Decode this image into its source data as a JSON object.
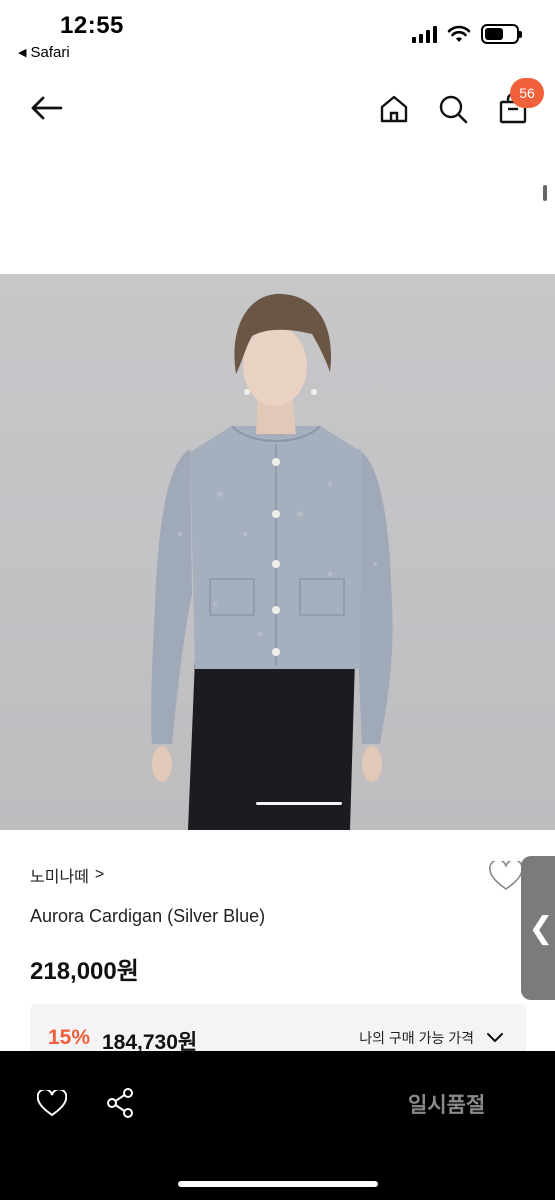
{
  "status_bar": {
    "time": "12:55",
    "back_app": "Safari"
  },
  "header": {
    "cart_count": "56"
  },
  "product": {
    "brand": "노미나떼",
    "brand_chevron": ">",
    "name": "Aurora Cardigan (Silver Blue)",
    "price": "218,000원",
    "discount": {
      "rate": "15%",
      "price": "184,730원",
      "my_price_label": "나의 구매 가능 가격"
    }
  },
  "side_tab": {
    "arrow": "❮"
  },
  "bottom_bar": {
    "status_label": "일시품절"
  },
  "icons": {
    "back": "back-arrow-icon",
    "home": "home-icon",
    "search": "search-icon",
    "bag": "shopping-bag-icon",
    "wish": "heart-icon",
    "share": "share-icon",
    "chevron": "chevron-down-icon"
  },
  "colors": {
    "accent": "#f0603a",
    "bottom_bar": "#000000",
    "soldout_text": "#8a8a8a",
    "discount_box": "#f4f4f6"
  }
}
